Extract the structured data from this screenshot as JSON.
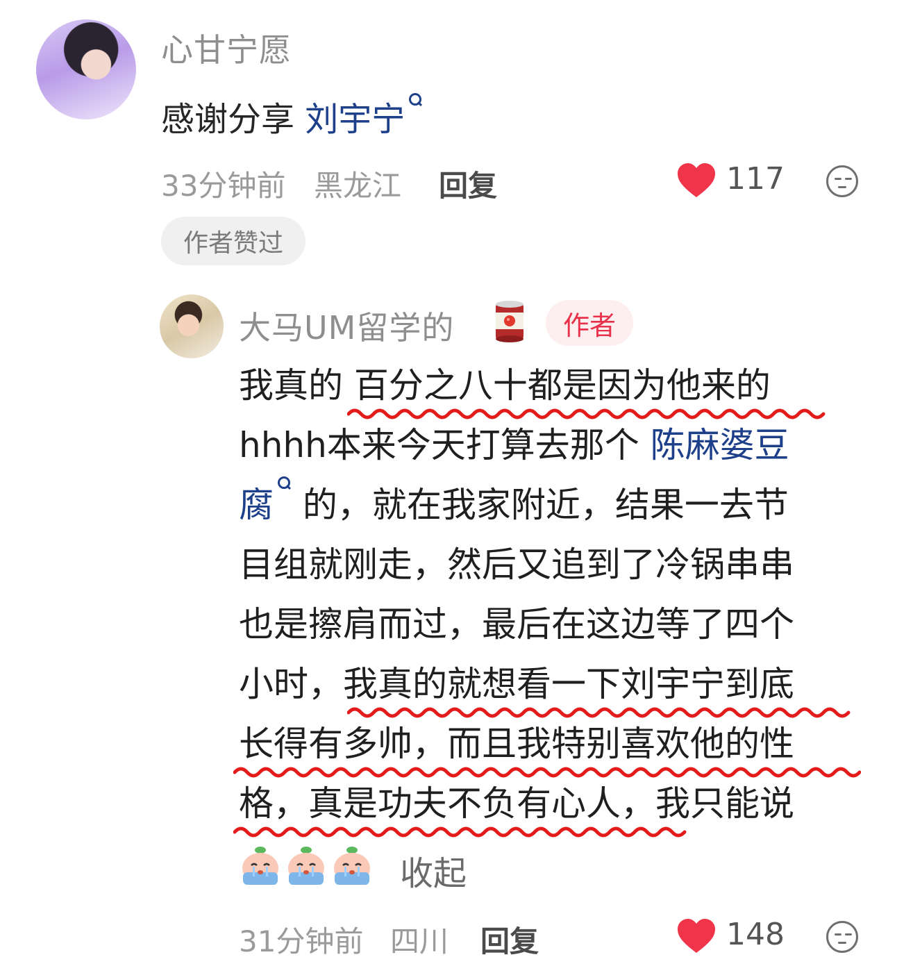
{
  "comment": {
    "username": "心甘宁愿",
    "text_prefix": "感谢分享 ",
    "text_link": "刘宇宁",
    "time": "33分钟前",
    "location": "黑龙江",
    "reply_label": "回复",
    "likes": "117",
    "liked_by_author": "作者赞过"
  },
  "reply": {
    "username": "大马UM留学的",
    "author_badge": "作者",
    "lines": [
      {
        "a": "我真的 ",
        "b": "百分之八十都是因为他来的"
      },
      {
        "a": "hhhh本来今天打算去那个 ",
        "link": "陈麻婆豆"
      },
      {
        "link": "腐",
        "c": " 的，就在我家附近，结果一去节"
      },
      {
        "a": "目组就刚走，然后又追到了冷锅串串"
      },
      {
        "a": "也是擦肩而过，最后在这边等了四个"
      },
      {
        "a": "小时，",
        "b": "我真的就想看一下刘宇宁到底"
      },
      {
        "a": "长得有多帅，而且我特别喜欢他的性"
      },
      {
        "a": "格，真是功夫不负有心人，",
        "c": "我只能说"
      }
    ],
    "collapse_label": "收起",
    "time": "31分钟前",
    "location": "四川",
    "reply_label": "回复",
    "likes": "148"
  },
  "colors": {
    "heart": "#f0344a",
    "underline": "#e31b1b",
    "link": "#1e3f8a",
    "author_badge": "#e8324a"
  },
  "icons": [
    "search-icon",
    "heart-icon",
    "face-icon",
    "tomato-can-icon",
    "crying-peach-emoji"
  ]
}
